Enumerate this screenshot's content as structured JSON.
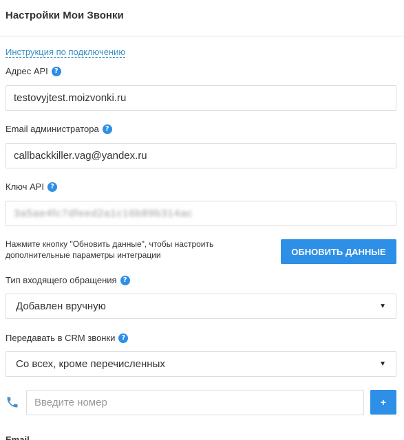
{
  "header": {
    "title": "Настройки Мои Звонки"
  },
  "instructions_link": "Инструкция по подключению",
  "api_address": {
    "label": "Адрес API",
    "value": "testovyjtest.moizvonki.ru"
  },
  "admin_email": {
    "label": "Email администратора",
    "value": "callbackkiller.vag@yandex.ru"
  },
  "api_key": {
    "label": "Ключ API",
    "value": "3a5ae4fc7dfeed2a1c16b89b314ac"
  },
  "update": {
    "hint": "Нажмите кнопку \"Обновить данные\", чтобы настроить дополнительные параметры интеграции",
    "button_label": "ОБНОВИТЬ ДАННЫЕ"
  },
  "incoming_type": {
    "label": "Тип входящего обращения",
    "selected": "Добавлен вручную"
  },
  "crm_calls": {
    "label": "Передавать в CRM звонки",
    "selected": "Со всех, кроме перечисленных"
  },
  "phone": {
    "placeholder": "Введите номер",
    "add_label": "+"
  },
  "next_section_label": "Email",
  "icons": {
    "help": "question-icon",
    "phone": "phone-icon",
    "dropdown": "caret-down-icon"
  },
  "colors": {
    "accent": "#2d8fe6",
    "link": "#3b8fc4"
  }
}
